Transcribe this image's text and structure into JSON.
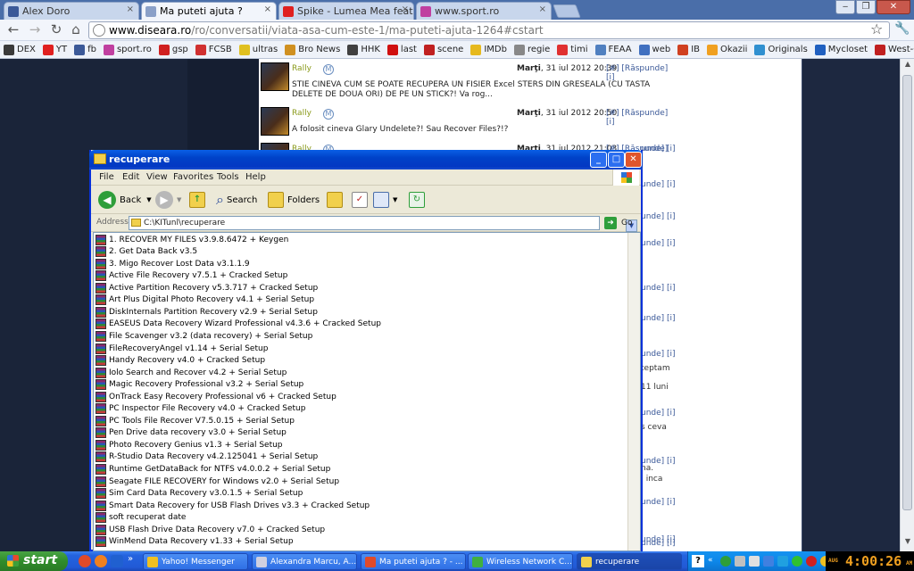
{
  "browser": {
    "tabs": [
      {
        "label": "Alex Doro",
        "icon": "facebook-icon",
        "color": "#3b5998"
      },
      {
        "label": "Ma puteti ajuta ?",
        "icon": "page-icon",
        "color": "#8aa0c8",
        "active": true
      },
      {
        "label": "Spike - Lumea Mea feat. Gue",
        "icon": "youtube-icon",
        "color": "#e02020"
      },
      {
        "label": "www.sport.ro",
        "icon": "sport-icon",
        "color": "#c040a0"
      }
    ],
    "url_host": "www.diseara.ro",
    "url_path": "/ro/conversatii/viata-asa-cum-este-1/ma-puteti-ajuta-1264#cstart",
    "bookmarks": [
      {
        "label": "DEX",
        "color": "#3a3a3a"
      },
      {
        "label": "YT",
        "color": "#e02020"
      },
      {
        "label": "fb",
        "color": "#3b5998"
      },
      {
        "label": "sport.ro",
        "color": "#c040a0"
      },
      {
        "label": "gsp",
        "color": "#d02020"
      },
      {
        "label": "FCSB",
        "color": "#d03030"
      },
      {
        "label": "ultras",
        "color": "#e0c020"
      },
      {
        "label": "Bro News",
        "color": "#d09020"
      },
      {
        "label": "HHK",
        "color": "#404040"
      },
      {
        "label": "last",
        "color": "#d01010"
      },
      {
        "label": "scene",
        "color": "#c02020"
      },
      {
        "label": "IMDb",
        "color": "#e6b91e"
      },
      {
        "label": "regie",
        "color": "#888888"
      },
      {
        "label": "timi",
        "color": "#e03030"
      },
      {
        "label": "FEAA",
        "color": "#5080c0"
      },
      {
        "label": "web",
        "color": "#4070c0"
      },
      {
        "label": "IB",
        "color": "#d04020"
      },
      {
        "label": "Okazii",
        "color": "#f0a020"
      },
      {
        "label": "Originals",
        "color": "#3090d0"
      },
      {
        "label": "Mycloset",
        "color": "#2060c0"
      },
      {
        "label": "West-Coast",
        "color": "#c02020"
      }
    ]
  },
  "comments": [
    {
      "user": "Rally",
      "badge": "M",
      "day": "Marţi",
      "date": "31 iul 2012 20:39",
      "actions": "[#] [Răspunde] [i]",
      "body": "STIE CINEVA CUM SE POATE RECUPERA UN FISIER Excel STERS DIN GRESEALA (CU TASTA DELETE DE DOUA ORI) DE PE UN STICK?! Va rog..."
    },
    {
      "user": "Rally",
      "badge": "M",
      "day": "Marţi",
      "date": "31 iul 2012 20:50",
      "actions": "[#] [Răspunde] [i]",
      "body": "A folosit cineva Glary Undelete?! Sau Recover Files?!?"
    },
    {
      "user": "Rally",
      "badge": "M",
      "day": "Marţi",
      "date": "31 iul 2012 21:03",
      "actions": "[#] [Răspunde] [i]",
      "body": ""
    }
  ],
  "side_fragments": [
    {
      "text": "unde] [i]",
      "gray": false
    },
    {
      "text": "unde] [i]",
      "gray": false
    },
    {
      "text": "unde] [i]",
      "gray": false
    },
    {
      "text": "unde] [i]",
      "gray": false
    },
    {
      "text": "unde] [i]",
      "gray": false
    },
    {
      "text": "unde] [i]",
      "gray": false
    },
    {
      "text": "unde] [i]",
      "gray": false
    },
    {
      "text": "teptam",
      "gray": true
    },
    {
      "text": "11 luni",
      "gray": true
    },
    {
      "text": "unde] [i]",
      "gray": false
    },
    {
      "text": "s ceva",
      "gray": true
    },
    {
      "text": "unde] [i]",
      "gray": false
    },
    {
      "text": "na.",
      "gray": true
    },
    {
      "text": ", inca",
      "gray": true
    },
    {
      "text": "unde] [i]",
      "gray": false
    },
    {
      "text": "unde] [i]",
      "gray": false
    },
    {
      "text": "unde] [i]",
      "gray": false
    }
  ],
  "explorer": {
    "title": "recuperare",
    "menu": [
      "File",
      "Edit",
      "View",
      "Favorites",
      "Tools",
      "Help"
    ],
    "back_label": "Back",
    "search_label": "Search",
    "folders_label": "Folders",
    "address_label": "Address",
    "address_value": "C:\\KITunl\\recuperare",
    "go_label": "Go",
    "files": [
      "1. RECOVER MY FILES v3.9.8.6472 + Keygen",
      "2. Get Data Back v3.5",
      "3. Migo Recover Lost Data v3.1.1.9",
      "Active File Recovery v7.5.1 + Cracked Setup",
      "Active Partition Recovery v5.3.717 + Cracked Setup",
      "Art Plus Digital Photo Recovery v4.1 + Serial Setup",
      "DiskInternals Partition Recovery v2.9 + Serial Setup",
      "EASEUS Data Recovery Wizard Professional v4.3.6 + Cracked Setup",
      "File Scavenger v3.2 (data recovery) + Serial Setup",
      "FileRecoveryAngel v1.14 + Serial Setup",
      "Handy Recovery v4.0 + Cracked Setup",
      "Iolo Search and Recover v4.2 + Serial Setup",
      "Magic Recovery Professional v3.2 + Serial Setup",
      "OnTrack Easy Recovery Professional v6 + Cracked Setup",
      "PC Inspector File Recovery v4.0 + Cracked Setup",
      "PC Tools File Recover V7.5.0.15 + Serial Setup",
      "Pen Drive data recovery v3.0 + Serial Setup",
      "Photo Recovery Genius v1.3 + Serial Setup",
      "R-Studio Data Recovery v4.2.125041 + Serial Setup",
      "Runtime GetDataBack for NTFS v4.0.0.2 + Serial Setup",
      "Seagate FILE RECOVERY for Windows v2.0 + Serial Setup",
      "Sim Card Data Recovery v3.0.1.5 + Serial Setup",
      "Smart Data Recovery for USB Flash Drives v3.3 + Cracked Setup",
      "soft recuperat date",
      "USB Flash Drive Data Recovery v7.0 + Cracked Setup",
      "WinMend Data Recovery v1.33 + Serial Setup"
    ]
  },
  "taskbar": {
    "start_label": "start",
    "buttons": [
      {
        "label": "Yahoo! Messenger",
        "icon": "yahoo-icon",
        "color": "#f0c020"
      },
      {
        "label": "Alexandra Marcu, A...",
        "icon": "pen-icon",
        "color": "#d0d0e0"
      },
      {
        "label": "Ma puteti ajuta ? - ...",
        "icon": "chrome-icon",
        "color": "#e04a2a"
      },
      {
        "label": "Wireless Network C...",
        "icon": "wireless-icon",
        "color": "#40b040"
      },
      {
        "label": "recuperare",
        "icon": "folder-icon",
        "color": "#f1d04c",
        "active": true
      }
    ],
    "clock": "4:00:26",
    "clock_top": "AUG",
    "clock_ampm": "AM"
  }
}
